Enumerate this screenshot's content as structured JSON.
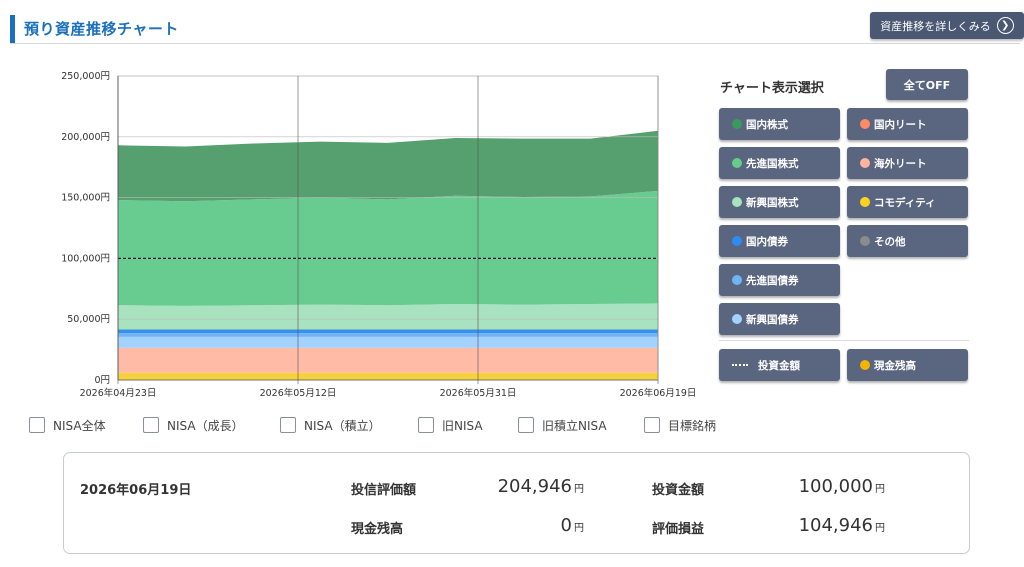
{
  "header": {
    "title": "預り資産推移チャート",
    "detail_button": "資産推移を詳しくみる"
  },
  "chart_data": {
    "type": "area",
    "stacked": true,
    "x": [
      "2026-04-23",
      "2026-04-30",
      "2026-05-07",
      "2026-05-14",
      "2026-05-21",
      "2026-05-28",
      "2026-06-04",
      "2026-06-11",
      "2026-06-19"
    ],
    "x_ticks": [
      "2026年04月23日",
      "2026年05月12日",
      "2026年05月31日",
      "2026年06月19日"
    ],
    "y_ticks": [
      "0円",
      "50,000円",
      "100,000円",
      "150,000円",
      "200,000円",
      "250,000円"
    ],
    "ylim": [
      0,
      250000
    ],
    "grid": true,
    "series": [
      {
        "name": "コモディティ",
        "color": "#f5d23c",
        "values": [
          6000,
          6000,
          6000,
          6000,
          6000,
          6000,
          6000,
          6000,
          6000
        ]
      },
      {
        "name": "海外リート",
        "color": "#ffbba6",
        "values": [
          20500,
          20500,
          20500,
          20500,
          20500,
          20500,
          20500,
          20500,
          20500
        ]
      },
      {
        "name": "新興国債券",
        "color": "#a3d2ff",
        "values": [
          9000,
          9000,
          9000,
          9000,
          9000,
          9000,
          9000,
          9000,
          9000
        ]
      },
      {
        "name": "先進国債券",
        "color": "#6fb4f5",
        "values": [
          3000,
          3000,
          3000,
          3000,
          3000,
          3000,
          3000,
          3000,
          3000
        ]
      },
      {
        "name": "国内債券",
        "color": "#3a8fe8",
        "values": [
          3000,
          3000,
          3000,
          3000,
          3000,
          3000,
          3000,
          3000,
          3000
        ]
      },
      {
        "name": "新興国株式",
        "color": "#a8e2bf",
        "values": [
          20000,
          19500,
          20000,
          20500,
          20000,
          21000,
          20500,
          21000,
          21500
        ]
      },
      {
        "name": "先進国株式",
        "color": "#68cc91",
        "values": [
          86500,
          86000,
          87000,
          88000,
          87000,
          89000,
          88500,
          88500,
          92500
        ]
      },
      {
        "name": "国内株式",
        "color": "#55a06e",
        "values": [
          45000,
          45000,
          46000,
          46000,
          46500,
          47500,
          48000,
          47500,
          49446
        ]
      }
    ],
    "reference_line": {
      "name": "投資金額",
      "value": 100000
    }
  },
  "panel": {
    "title": "チャート表示選択",
    "all_off": "全てOFF",
    "items": [
      {
        "label": "国内株式",
        "color": "#3a9a5c"
      },
      {
        "label": "国内リート",
        "color": "#ff8a65"
      },
      {
        "label": "先進国株式",
        "color": "#66cc8a"
      },
      {
        "label": "海外リート",
        "color": "#ffb49c"
      },
      {
        "label": "新興国株式",
        "color": "#a8e2bf"
      },
      {
        "label": "コモディティ",
        "color": "#ffd21f"
      },
      {
        "label": "国内債券",
        "color": "#2d8cf0"
      },
      {
        "label": "その他",
        "color": "#8c8c8c"
      },
      {
        "label": "先進国債券",
        "color": "#6fb4f5"
      },
      {
        "label": "新興国債券",
        "color": "#a3d2ff"
      }
    ],
    "invest_amount": "投資金額",
    "cash_balance": {
      "label": "現金残高",
      "color": "#f5b400"
    }
  },
  "filters": [
    "NISA全体",
    "NISA（成長）",
    "NISA（積立）",
    "旧NISA",
    "旧積立NISA",
    "目標銘柄"
  ],
  "summary": {
    "date": "2026年06月19日",
    "fund_value_label": "投信評価額",
    "fund_value": "204,946",
    "invest_label": "投資金額",
    "invest_value": "100,000",
    "cash_label": "現金残高",
    "cash_value": "0",
    "pl_label": "評価損益",
    "pl_value": "104,946",
    "unit": "円"
  }
}
